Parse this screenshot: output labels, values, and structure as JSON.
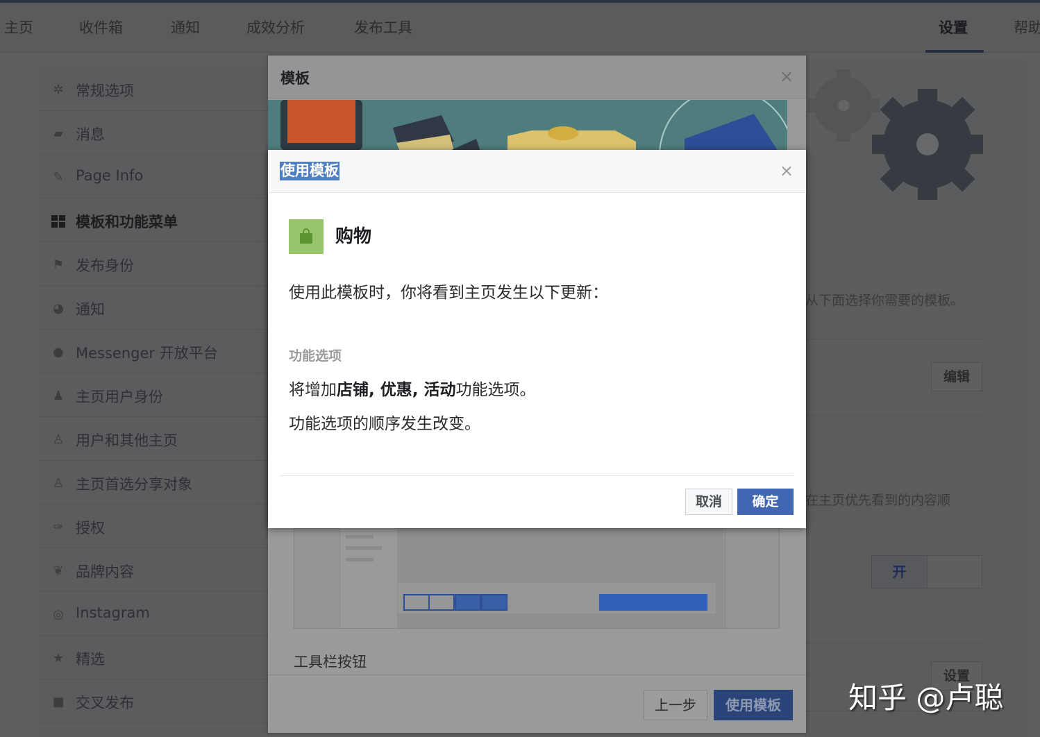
{
  "topnav": {
    "tabs": [
      {
        "label": "主页"
      },
      {
        "label": "收件箱"
      },
      {
        "label": "通知"
      },
      {
        "label": "成效分析"
      },
      {
        "label": "发布工具"
      },
      {
        "label": "设置",
        "active": true
      },
      {
        "label": "帮助"
      }
    ]
  },
  "sidebar": {
    "items": [
      {
        "label": "常规选项",
        "icon": "gear-icon"
      },
      {
        "label": "消息",
        "icon": "chat-icon"
      },
      {
        "label": "Page Info",
        "icon": "pencil-icon"
      },
      {
        "label": "模板和功能菜单",
        "icon": "grid-icon",
        "active": true
      },
      {
        "label": "发布身份",
        "icon": "flag-icon"
      },
      {
        "label": "通知",
        "icon": "globe-icon"
      },
      {
        "label": "Messenger 开放平台",
        "icon": "messenger-icon"
      },
      {
        "label": "主页用户身份",
        "icon": "person-icon"
      },
      {
        "label": "用户和其他主页",
        "icon": "people-icon"
      },
      {
        "label": "主页首选分享对象",
        "icon": "people-icon"
      },
      {
        "label": "授权",
        "icon": "wrench-icon"
      },
      {
        "label": "品牌内容",
        "icon": "handshake-icon"
      },
      {
        "label": "Instagram",
        "icon": "instagram-icon"
      },
      {
        "label": "精选",
        "icon": "star-icon"
      },
      {
        "label": "交叉发布",
        "icon": "video-icon"
      }
    ]
  },
  "background": {
    "template_hint": "从下面选择你需要的模板。",
    "edit_button": "编辑",
    "priority_hint": "在主页优先看到的内容顺",
    "toggle_on": "开",
    "settings_button": "设置"
  },
  "template_modal": {
    "title": "模板",
    "toolbar_label": "工具栏按钮",
    "prev_button": "上一步",
    "use_button": "使用模板"
  },
  "confirm_dialog": {
    "title": "使用模板",
    "template_name": "购物",
    "intro": "使用此模板时，你将看到主页发生以下更新：",
    "section_label": "功能选项",
    "change_prefix": "将增加",
    "change_tabs": "店铺, 优惠, 活动",
    "change_suffix": "功能选项。",
    "change_order": "功能选项的顺序发生改变。",
    "cancel_button": "取消",
    "confirm_button": "确定"
  },
  "watermark": "知乎 @卢聪",
  "colors": {
    "primary_button": "#4267b2",
    "shopping_icon_bg": "#98c46c",
    "selection_highlight": "#4e7ec4"
  }
}
